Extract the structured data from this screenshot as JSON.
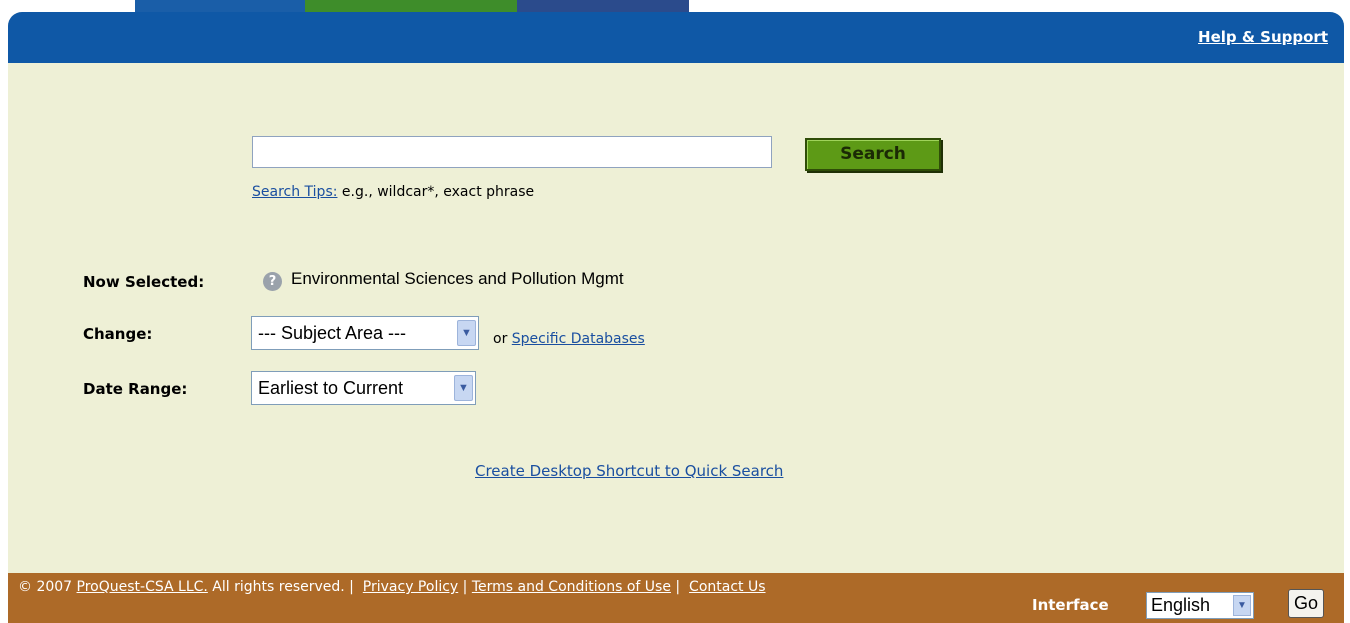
{
  "header": {
    "help_link": "Help & Support"
  },
  "search": {
    "button_label": "Search",
    "value": "",
    "tips_link": "Search Tips:",
    "tips_text": " e.g., wildcar*, exact phrase"
  },
  "selection": {
    "now_selected_label": "Now Selected:",
    "now_selected_value": "Environmental Sciences and Pollution Mgmt",
    "change_label": "Change:",
    "subject_area_value": "--- Subject Area ---",
    "or_text": "or ",
    "specific_databases_link": "Specific Databases",
    "date_range_label": "Date Range:",
    "date_range_value": "Earliest to Current"
  },
  "shortcut_link": "Create Desktop Shortcut to Quick Search",
  "footer": {
    "copyright": "© 2007 ",
    "company_link": "ProQuest-CSA LLC.",
    "rights": " All rights reserved. | ",
    "privacy_link": "Privacy Policy",
    "sep": " | ",
    "terms_link": "Terms and Conditions of Use",
    "sep2": " | ",
    "contact_link": "Contact Us",
    "interface_label": "Interface",
    "language_value": "English",
    "go_label": "Go"
  },
  "colors": {
    "header_blue": "#0f58a6",
    "background": "#eef0d6",
    "footer_brown": "#ad6a28",
    "search_green": "#5d9a16",
    "link_blue": "#1a4fa0"
  },
  "icons": {
    "help_icon": "question-circle",
    "dropdown": "chevron-down"
  }
}
